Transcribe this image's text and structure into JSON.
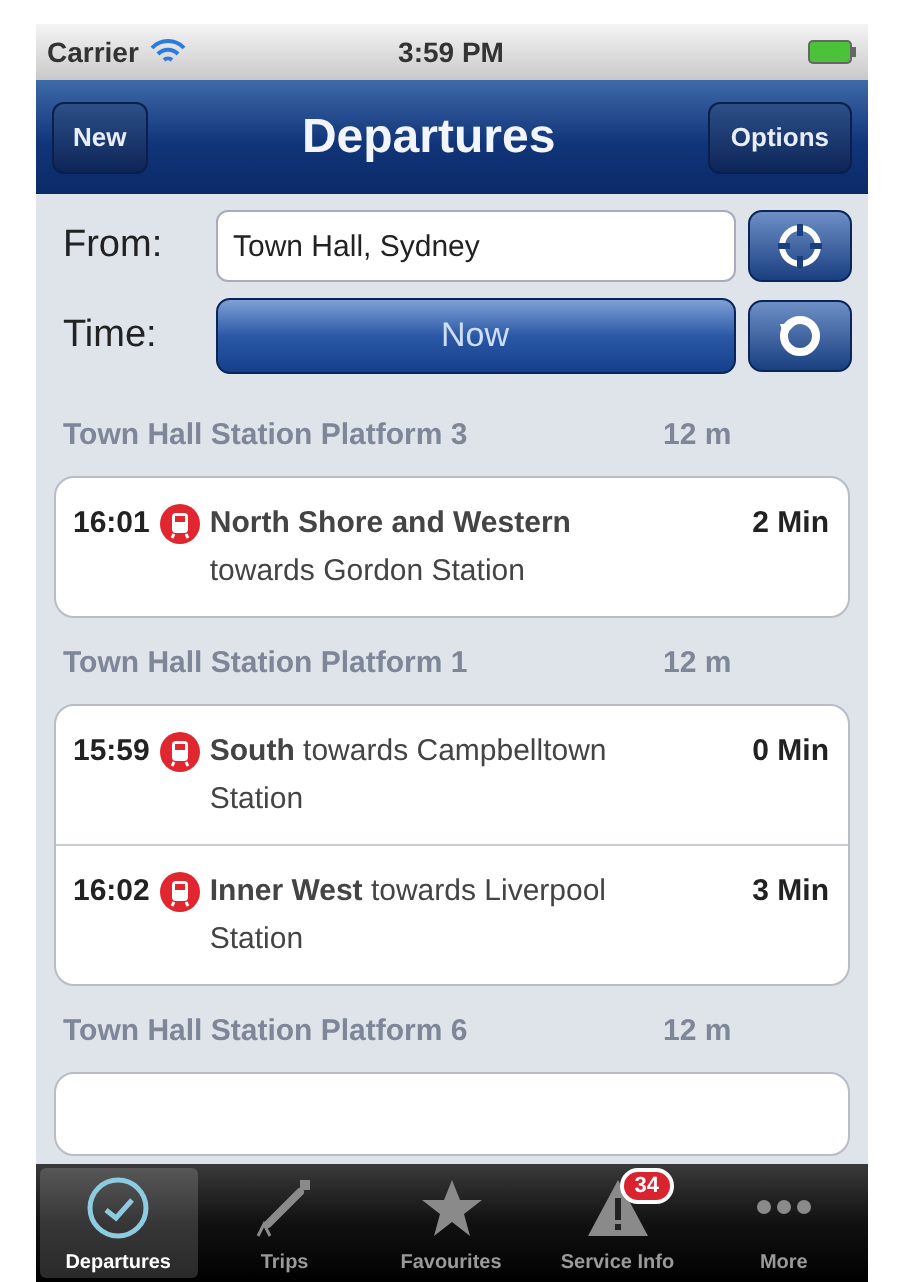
{
  "status_bar": {
    "carrier": "Carrier",
    "time": "3:59 PM"
  },
  "nav_bar": {
    "title": "Departures",
    "left_button": "New",
    "right_button": "Options"
  },
  "form": {
    "from_label": "From:",
    "from_value": "Town Hall, Sydney",
    "time_label": "Time:",
    "time_value": "Now"
  },
  "sections": [
    {
      "title": "Town Hall Station Platform 3",
      "distance": "12 m",
      "departures": [
        {
          "time": "16:01",
          "service": "**North Shore and Western** towards Gordon Station",
          "due": "2 Min"
        }
      ]
    },
    {
      "title": "Town Hall Station Platform 1",
      "distance": "12 m",
      "departures": [
        {
          "time": "15:59",
          "service": "**South** towards Campbelltown Station",
          "due": "0 Min"
        },
        {
          "time": "16:02",
          "service": "**Inner West** towards Liverpool Station",
          "due": "3 Min"
        }
      ]
    },
    {
      "title": "Town Hall Station Platform 6",
      "distance": "12 m"
    }
  ],
  "tab_bar": [
    {
      "kind": "clock",
      "label": "Departures",
      "selected": true
    },
    {
      "kind": "route",
      "label": "Trips",
      "selected": false
    },
    {
      "kind": "star",
      "label": "Favourites",
      "selected": false
    },
    {
      "kind": "warning",
      "label": "Service Info",
      "selected": false,
      "badge": "34"
    },
    {
      "kind": "more",
      "label": "More",
      "selected": false
    }
  ]
}
